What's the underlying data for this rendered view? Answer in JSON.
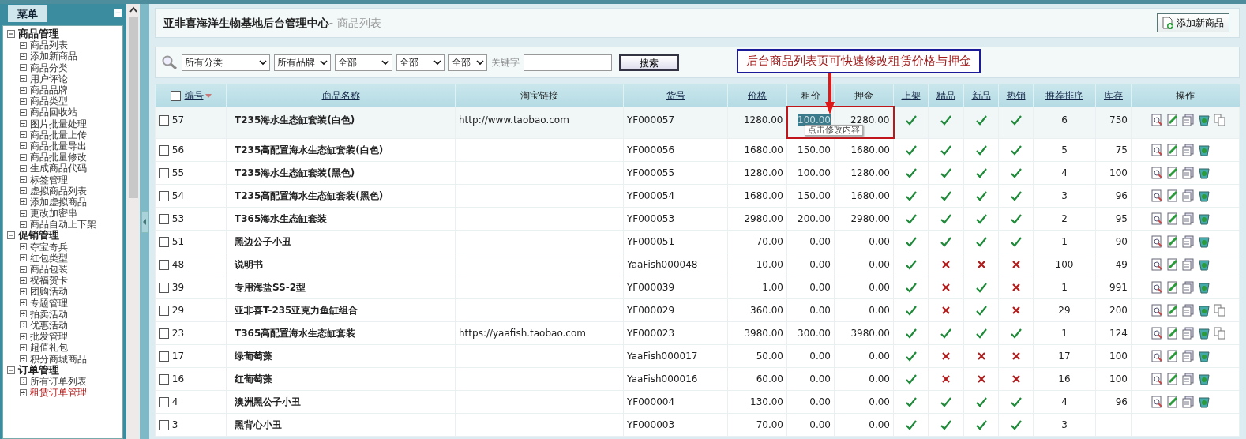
{
  "sidebar": {
    "title": "菜单",
    "collapse_icon": "−",
    "groups": [
      {
        "label": "商品管理",
        "expanded": true,
        "children": [
          {
            "label": "商品列表",
            "selected": false
          },
          {
            "label": "添加新商品",
            "selected": false
          },
          {
            "label": "商品分类",
            "selected": false
          },
          {
            "label": "用户评论",
            "selected": false
          },
          {
            "label": "商品品牌",
            "selected": false
          },
          {
            "label": "商品类型",
            "selected": false
          },
          {
            "label": "商品回收站",
            "selected": false
          },
          {
            "label": "图片批量处理",
            "selected": false
          },
          {
            "label": "商品批量上传",
            "selected": false
          },
          {
            "label": "商品批量导出",
            "selected": false
          },
          {
            "label": "商品批量修改",
            "selected": false
          },
          {
            "label": "生成商品代码",
            "selected": false
          },
          {
            "label": "标签管理",
            "selected": false
          },
          {
            "label": "虚拟商品列表",
            "selected": false
          },
          {
            "label": "添加虚拟商品",
            "selected": false
          },
          {
            "label": "更改加密串",
            "selected": false
          },
          {
            "label": "商品自动上下架",
            "selected": false
          }
        ]
      },
      {
        "label": "促销管理",
        "expanded": true,
        "children": [
          {
            "label": "夺宝奇兵",
            "selected": false
          },
          {
            "label": "红包类型",
            "selected": false
          },
          {
            "label": "商品包装",
            "selected": false
          },
          {
            "label": "祝福贺卡",
            "selected": false
          },
          {
            "label": "团购活动",
            "selected": false
          },
          {
            "label": "专题管理",
            "selected": false
          },
          {
            "label": "拍卖活动",
            "selected": false
          },
          {
            "label": "优惠活动",
            "selected": false
          },
          {
            "label": "批发管理",
            "selected": false
          },
          {
            "label": "超值礼包",
            "selected": false
          },
          {
            "label": "积分商城商品",
            "selected": false
          }
        ]
      },
      {
        "label": "订单管理",
        "expanded": true,
        "children": [
          {
            "label": "所有订单列表",
            "selected": false
          },
          {
            "label": "租赁订单管理",
            "selected": true
          }
        ]
      }
    ]
  },
  "header": {
    "title": "亚非喜海洋生物基地后台管理中心",
    "subtitle": "- 商品列表",
    "add_button": "添加新商品"
  },
  "filters": {
    "selects": [
      "所有分类",
      "所有品牌",
      "全部",
      "全部",
      "全部"
    ],
    "keyword_label": "关键字",
    "search_button": "搜索"
  },
  "annotation": {
    "text": "后台商品列表页可快速修改租赁价格与押金"
  },
  "table": {
    "header_checked": false,
    "columns": [
      {
        "label": "编号",
        "link": true,
        "sorted": true
      },
      {
        "label": "商品名称",
        "link": true,
        "sorted": false
      },
      {
        "label": "淘宝链接",
        "link": false,
        "sorted": false
      },
      {
        "label": "货号",
        "link": true,
        "sorted": false
      },
      {
        "label": "价格",
        "link": true,
        "sorted": false
      },
      {
        "label": "租价",
        "link": false,
        "sorted": false
      },
      {
        "label": "押金",
        "link": false,
        "sorted": false
      },
      {
        "label": "上架",
        "link": true,
        "sorted": false
      },
      {
        "label": "精品",
        "link": true,
        "sorted": false
      },
      {
        "label": "新品",
        "link": true,
        "sorted": false
      },
      {
        "label": "热销",
        "link": true,
        "sorted": false
      },
      {
        "label": "推荐排序",
        "link": true,
        "sorted": false
      },
      {
        "label": "库存",
        "link": true,
        "sorted": false
      },
      {
        "label": "操作",
        "link": false,
        "sorted": false
      }
    ],
    "rows": [
      {
        "checked": false,
        "highlighted": true,
        "editing": true,
        "edit_tooltip": "点击修改内容",
        "id": "57",
        "name": "T235海水生态缸套装(白色)",
        "taobao": "http://www.taobao.com",
        "sku": "YF000057",
        "price": "1280.00",
        "rent": "100.00",
        "deposit": "2280.00",
        "on_sale": true,
        "best": true,
        "new": true,
        "hot": true,
        "sort_order": "6",
        "stock": "750",
        "action_icons": true,
        "copy_icon": true
      },
      {
        "checked": false,
        "highlighted": false,
        "editing": false,
        "id": "56",
        "name": "T235高配置海水生态缸套装(白色)",
        "sku": "YF000056",
        "price": "1680.00",
        "rent": "150.00",
        "deposit": "1680.00",
        "on_sale": true,
        "best": true,
        "new": true,
        "hot": true,
        "sort_order": "5",
        "stock": "75",
        "action_icons": true,
        "copy_icon": false
      },
      {
        "checked": false,
        "highlighted": false,
        "editing": false,
        "id": "55",
        "name": "T235海水生态缸套装(黑色)",
        "sku": "YF000055",
        "price": "1280.00",
        "rent": "100.00",
        "deposit": "1280.00",
        "on_sale": true,
        "best": true,
        "new": true,
        "hot": true,
        "sort_order": "4",
        "stock": "100",
        "action_icons": true,
        "copy_icon": false
      },
      {
        "checked": false,
        "highlighted": false,
        "editing": false,
        "id": "54",
        "name": "T235高配置海水生态缸套装(黑色)",
        "sku": "YF000054",
        "price": "1680.00",
        "rent": "150.00",
        "deposit": "1680.00",
        "on_sale": true,
        "best": true,
        "new": true,
        "hot": true,
        "sort_order": "3",
        "stock": "96",
        "action_icons": true,
        "copy_icon": false
      },
      {
        "checked": false,
        "highlighted": false,
        "editing": false,
        "id": "53",
        "name": "T365海水生态缸套装",
        "sku": "YF000053",
        "price": "2980.00",
        "rent": "200.00",
        "deposit": "2980.00",
        "on_sale": true,
        "best": true,
        "new": true,
        "hot": true,
        "sort_order": "2",
        "stock": "95",
        "action_icons": true,
        "copy_icon": false
      },
      {
        "checked": false,
        "highlighted": false,
        "editing": false,
        "id": "51",
        "name": "黑边公子小丑",
        "sku": "YF000051",
        "price": "70.00",
        "rent": "0.00",
        "deposit": "0.00",
        "on_sale": true,
        "best": true,
        "new": true,
        "hot": true,
        "sort_order": "1",
        "stock": "90",
        "action_icons": true,
        "copy_icon": false
      },
      {
        "checked": false,
        "highlighted": false,
        "editing": false,
        "id": "48",
        "name": "说明书",
        "sku": "YaaFish000048",
        "price": "10.00",
        "rent": "0.00",
        "deposit": "0.00",
        "on_sale": true,
        "best": false,
        "new": false,
        "hot": false,
        "sort_order": "100",
        "stock": "49",
        "action_icons": true,
        "copy_icon": false
      },
      {
        "checked": false,
        "highlighted": false,
        "editing": false,
        "id": "39",
        "name": "专用海盐SS-2型",
        "sku": "YF000039",
        "price": "1.00",
        "rent": "0.00",
        "deposit": "0.00",
        "on_sale": true,
        "best": false,
        "new": true,
        "hot": false,
        "sort_order": "1",
        "stock": "991",
        "action_icons": true,
        "copy_icon": false
      },
      {
        "checked": false,
        "highlighted": false,
        "editing": false,
        "id": "29",
        "name": "亚非喜T-235亚克力鱼缸组合",
        "sku": "YF000029",
        "price": "360.00",
        "rent": "0.00",
        "deposit": "0.00",
        "on_sale": true,
        "best": false,
        "new": true,
        "hot": false,
        "sort_order": "29",
        "stock": "200",
        "action_icons": true,
        "copy_icon": true
      },
      {
        "checked": false,
        "highlighted": false,
        "editing": false,
        "id": "23",
        "name": "T365高配置海水生态缸套装",
        "taobao": "https://yaafish.taobao.com",
        "sku": "YF000023",
        "price": "3980.00",
        "rent": "300.00",
        "deposit": "3980.00",
        "on_sale": true,
        "best": true,
        "new": true,
        "hot": true,
        "sort_order": "1",
        "stock": "124",
        "action_icons": true,
        "copy_icon": true
      },
      {
        "checked": false,
        "highlighted": false,
        "editing": false,
        "id": "17",
        "name": "绿葡萄藻",
        "sku": "YaaFish000017",
        "price": "50.00",
        "rent": "0.00",
        "deposit": "0.00",
        "on_sale": true,
        "best": false,
        "new": false,
        "hot": false,
        "sort_order": "17",
        "stock": "100",
        "action_icons": true,
        "copy_icon": false
      },
      {
        "checked": false,
        "highlighted": false,
        "editing": false,
        "id": "16",
        "name": "红葡萄藻",
        "sku": "YaaFish000016",
        "price": "60.00",
        "rent": "0.00",
        "deposit": "0.00",
        "on_sale": true,
        "best": false,
        "new": false,
        "hot": false,
        "sort_order": "16",
        "stock": "100",
        "action_icons": true,
        "copy_icon": false
      },
      {
        "checked": false,
        "highlighted": false,
        "editing": false,
        "id": "4",
        "name": "澳洲黑公子小丑",
        "sku": "YF000004",
        "price": "130.00",
        "rent": "0.00",
        "deposit": "0.00",
        "on_sale": true,
        "best": true,
        "new": true,
        "hot": true,
        "sort_order": "4",
        "stock": "96",
        "action_icons": true,
        "copy_icon": false
      },
      {
        "checked": false,
        "highlighted": false,
        "editing": false,
        "id": "3",
        "name": "黑背心小丑",
        "sku": "YF000003",
        "price": "70.00",
        "rent": "0.00",
        "deposit": "0.00",
        "on_sale": true,
        "best": true,
        "new": true,
        "hot": true,
        "sort_order": "3",
        "action_icons": false,
        "copy_icon": false
      }
    ]
  }
}
